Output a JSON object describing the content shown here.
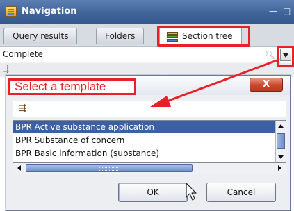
{
  "navigation": {
    "title": "Navigation",
    "window_buttons": {
      "minimize": "—",
      "restore": "□"
    },
    "tabs": [
      {
        "label": "Query results"
      },
      {
        "label": "Folders"
      },
      {
        "label": "Section tree",
        "active": true
      }
    ],
    "filter_value": "Complete",
    "highlight_color": "#e8202a"
  },
  "dialog": {
    "title": "Select a template",
    "close_label": "X",
    "items": [
      {
        "label": "BPR Active substance application",
        "selected": true
      },
      {
        "label": "BPR Substance of concern",
        "selected": false
      },
      {
        "label": "BPR Basic information (substance)",
        "selected": false
      }
    ],
    "ok_label": "OK",
    "cancel_label": "Cancel"
  },
  "icons": {
    "app": "navigation-window-icon",
    "section_tree": "books-icon",
    "search": "magnifier-icon",
    "dropdown": "chevron-down-icon",
    "filter": "filter-icon"
  }
}
